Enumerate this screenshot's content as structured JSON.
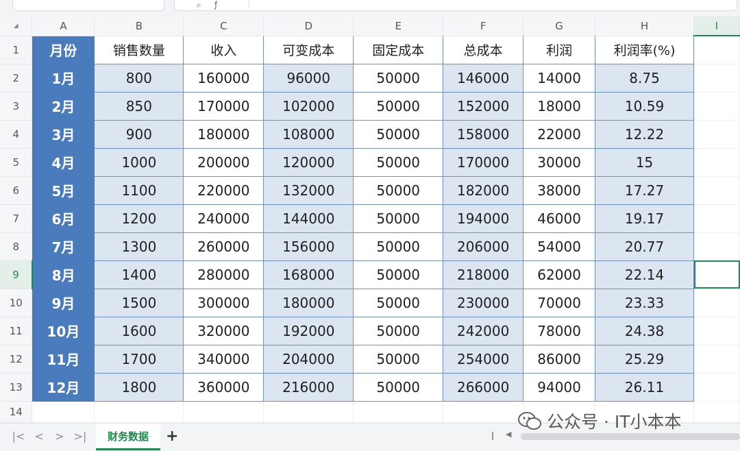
{
  "columns": [
    "A",
    "B",
    "C",
    "D",
    "E",
    "F",
    "G",
    "H",
    "I"
  ],
  "selected_column": "I",
  "selected_row": 9,
  "header_row": [
    "月份",
    "销售数量",
    "收入",
    "可变成本",
    "固定成本",
    "总成本",
    "利润",
    "利润率(%)"
  ],
  "rows": [
    {
      "num": "2",
      "cells": [
        "1月",
        "800",
        "160000",
        "96000",
        "50000",
        "146000",
        "14000",
        "8.75"
      ]
    },
    {
      "num": "3",
      "cells": [
        "2月",
        "850",
        "170000",
        "102000",
        "50000",
        "152000",
        "18000",
        "10.59"
      ]
    },
    {
      "num": "4",
      "cells": [
        "3月",
        "900",
        "180000",
        "108000",
        "50000",
        "158000",
        "22000",
        "12.22"
      ]
    },
    {
      "num": "5",
      "cells": [
        "4月",
        "1000",
        "200000",
        "120000",
        "50000",
        "170000",
        "30000",
        "15"
      ]
    },
    {
      "num": "6",
      "cells": [
        "5月",
        "1100",
        "220000",
        "132000",
        "50000",
        "182000",
        "38000",
        "17.27"
      ]
    },
    {
      "num": "7",
      "cells": [
        "6月",
        "1200",
        "240000",
        "144000",
        "50000",
        "194000",
        "46000",
        "19.17"
      ]
    },
    {
      "num": "8",
      "cells": [
        "7月",
        "1300",
        "260000",
        "156000",
        "50000",
        "206000",
        "54000",
        "20.77"
      ]
    },
    {
      "num": "9",
      "cells": [
        "8月",
        "1400",
        "280000",
        "168000",
        "50000",
        "218000",
        "62000",
        "22.14"
      ]
    },
    {
      "num": "10",
      "cells": [
        "9月",
        "1500",
        "300000",
        "180000",
        "50000",
        "230000",
        "70000",
        "23.33"
      ]
    },
    {
      "num": "11",
      "cells": [
        "10月",
        "1600",
        "320000",
        "192000",
        "50000",
        "242000",
        "78000",
        "24.38"
      ]
    },
    {
      "num": "12",
      "cells": [
        "11月",
        "1700",
        "340000",
        "204000",
        "50000",
        "254000",
        "86000",
        "25.29"
      ]
    },
    {
      "num": "13",
      "cells": [
        "12月",
        "1800",
        "360000",
        "216000",
        "50000",
        "266000",
        "94000",
        "26.11"
      ]
    }
  ],
  "row_numbers": {
    "header": "1",
    "last": "14"
  },
  "sheet_tab": "财务数据",
  "add_sheet": "+",
  "nav": {
    "first": "|<",
    "prev": "<",
    "next": ">",
    "last": ">|"
  },
  "watermark": "公众号 · IT小本本",
  "colors": {
    "month_fill": "#4a7bbd",
    "shade_fill": "#dce6f1",
    "accent": "#1e8a4c",
    "border": "#6f8fc7"
  }
}
